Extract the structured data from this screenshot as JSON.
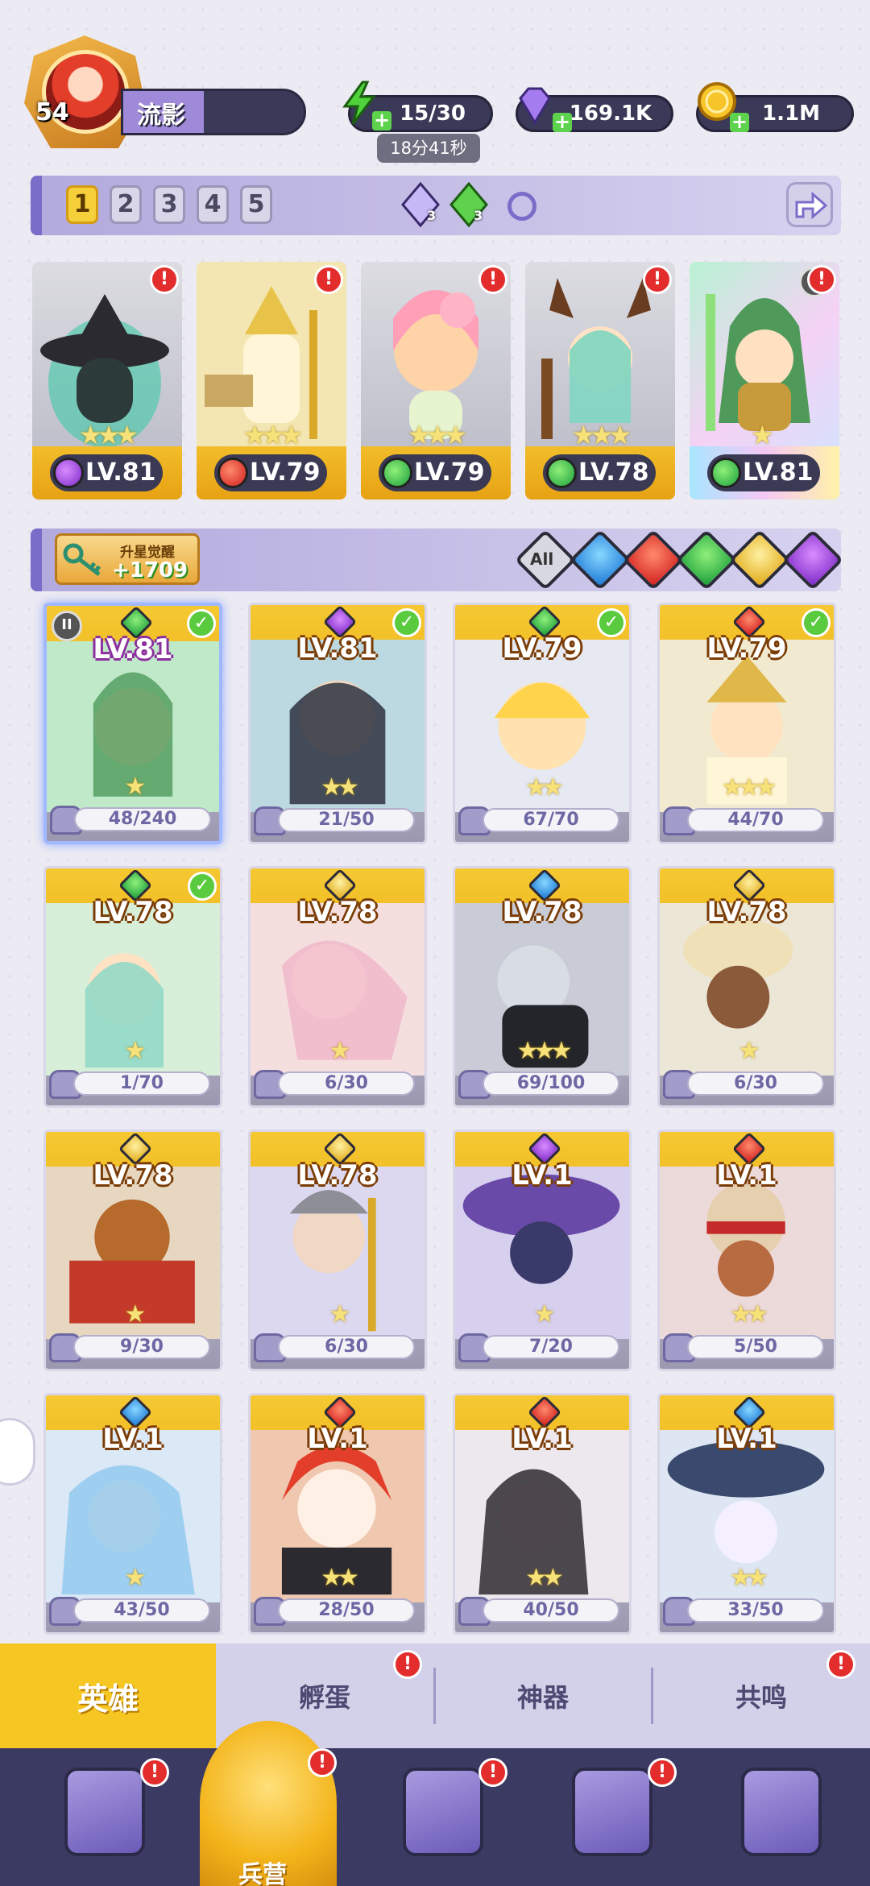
{
  "player": {
    "level": "54",
    "name": "流影"
  },
  "resources": {
    "energy": "15/30",
    "energy_timer": "18分41秒",
    "gems": "169.1K",
    "gold": "1.1M"
  },
  "team_bar": {
    "slots": [
      "1",
      "2",
      "3",
      "4",
      "5"
    ],
    "gem_counts": [
      "3",
      "3"
    ]
  },
  "team": [
    {
      "level": "LV.81",
      "element": "dark"
    },
    {
      "level": "LV.79",
      "element": "fire"
    },
    {
      "level": "LV.79",
      "element": "wind"
    },
    {
      "level": "LV.78",
      "element": "wind"
    },
    {
      "level": "LV.81",
      "element": "wind"
    }
  ],
  "awaken": {
    "label": "升星觉醒",
    "value": "+1709"
  },
  "filters": {
    "all_label": "All"
  },
  "heroes": [
    {
      "level": "LV.81",
      "progress": "48/240",
      "element": "wind",
      "checked": true
    },
    {
      "level": "LV.81",
      "progress": "21/50",
      "element": "dark",
      "checked": true
    },
    {
      "level": "LV.79",
      "progress": "67/70",
      "element": "wind",
      "checked": true
    },
    {
      "level": "LV.79",
      "progress": "44/70",
      "element": "fire",
      "checked": true
    },
    {
      "level": "LV.78",
      "progress": "1/70",
      "element": "wind",
      "checked": true
    },
    {
      "level": "LV.78",
      "progress": "6/30",
      "element": "light",
      "checked": false
    },
    {
      "level": "LV.78",
      "progress": "69/100",
      "element": "water",
      "checked": false
    },
    {
      "level": "LV.78",
      "progress": "6/30",
      "element": "light",
      "checked": false
    },
    {
      "level": "LV.78",
      "progress": "9/30",
      "element": "light",
      "checked": false
    },
    {
      "level": "LV.78",
      "progress": "6/30",
      "element": "light",
      "checked": false
    },
    {
      "level": "LV.1",
      "progress": "7/20",
      "element": "dark",
      "checked": false
    },
    {
      "level": "LV.1",
      "progress": "5/50",
      "element": "fire",
      "checked": false
    },
    {
      "level": "LV.1",
      "progress": "43/50",
      "element": "water",
      "checked": false
    },
    {
      "level": "LV.1",
      "progress": "28/50",
      "element": "fire",
      "checked": false
    },
    {
      "level": "LV.1",
      "progress": "40/50",
      "element": "fire",
      "checked": false
    },
    {
      "level": "LV.1",
      "progress": "33/50",
      "element": "water",
      "checked": false
    }
  ],
  "tabs": [
    "英雄",
    "孵蛋",
    "神器",
    "共鸣"
  ],
  "bottom_nav": {
    "center_label": "兵营"
  },
  "colors": {
    "accent_yellow": "#f6c623",
    "nav_bg": "#3b3a63",
    "alert_red": "#e32c2c"
  }
}
